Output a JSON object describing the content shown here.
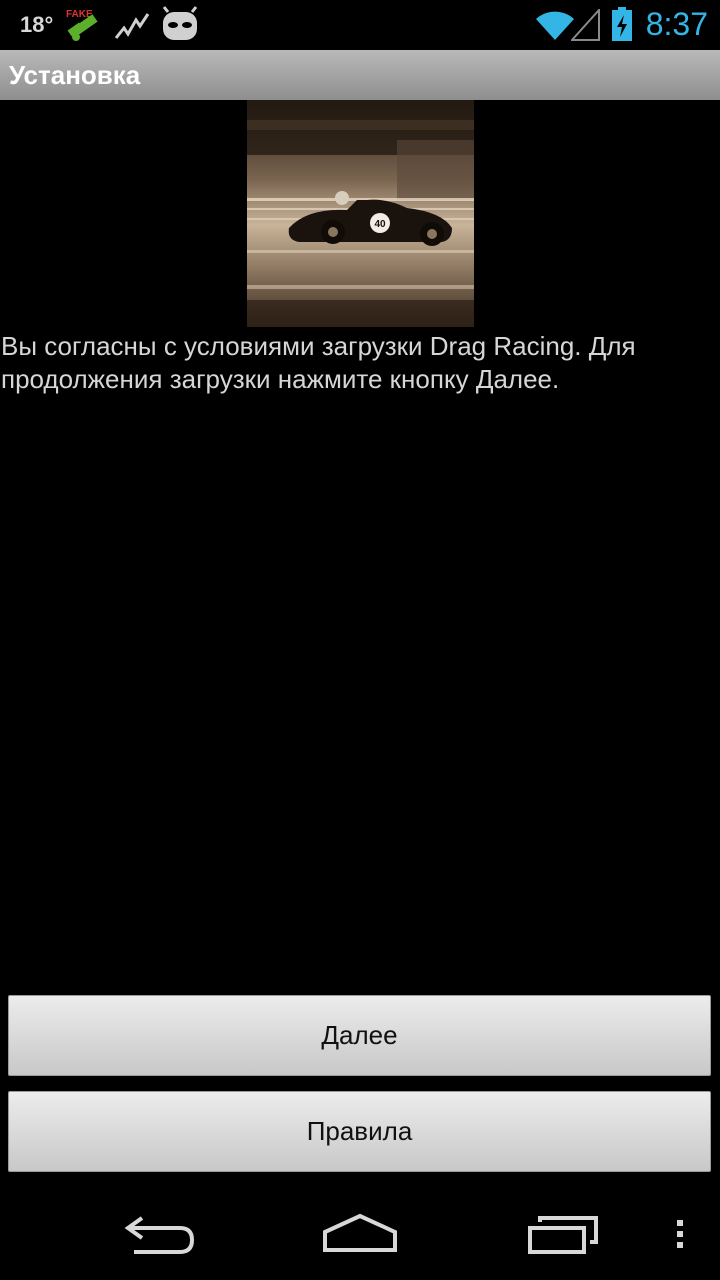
{
  "status_bar": {
    "temperature": "18°",
    "clock": "8:37",
    "icons": [
      "fake-gps-icon",
      "activity-graph-icon",
      "cyanogen-mascot-icon",
      "wifi-icon",
      "signal-icon",
      "battery-charging-icon"
    ],
    "fake_label": "FAKE",
    "clock_color": "#33b5e5"
  },
  "title_bar": {
    "title": "Установка"
  },
  "main": {
    "image": "race-car-photo",
    "message": "Вы согласны с условиями  загрузки Drag Racing. Для продолжения загрузки нажмите кнопку Далее."
  },
  "buttons": {
    "next_label": "Далее",
    "rules_label": "Правила"
  },
  "nav_bar": {
    "icons": [
      "back-icon",
      "home-icon",
      "recent-apps-icon",
      "menu-overflow-icon"
    ]
  }
}
